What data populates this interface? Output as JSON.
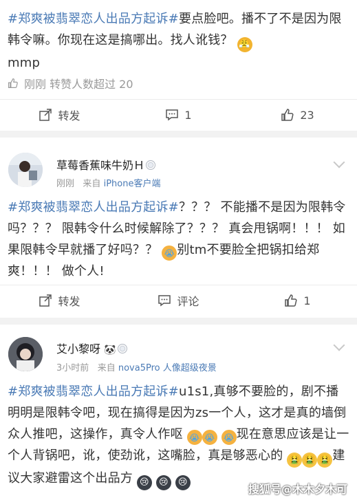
{
  "post1": {
    "text_hashtag": "#郑爽被翡翠恋人出品方起诉#",
    "text_body": "要点脸吧。播不了不是因为限韩令嘛。你现在这是搞哪出。找人讹钱？",
    "text_tail": "mmp",
    "emoji_icon": "angry-face-icon",
    "repost_note": "刚刚 转赞人数超过 20",
    "actions": {
      "repost": "转发",
      "comment": "1",
      "like": "23"
    }
  },
  "post2": {
    "username": "草莓香蕉味牛奶Ｈ",
    "meta_time": "刚刚",
    "meta_from_prefix": "来自",
    "meta_source": "iPhone客户端",
    "text_hashtag": "#郑爽被翡翠恋人出品方起诉#",
    "text_body1": "？？？ 不能播不是因为限韩令吗？？？ 限韩令什么时候解除了？？？ 真会甩锅啊！！！ 如果限韩令早就播了好吗？？",
    "text_body2": "别tm不要脸全把锅扣给郑爽！！！ 做个人!",
    "actions": {
      "repost": "转发",
      "comment": "评论",
      "like": "1"
    }
  },
  "post3": {
    "username": "艾小黎呀",
    "meta_time": "3小时前",
    "meta_from_prefix": "来自",
    "meta_source": "nova5Pro 人像超级夜景",
    "text_hashtag": "#郑爽被翡翠恋人出品方起诉#",
    "text_body1": "u1s1,真够不要脸的，剧不播明明是限韩令吧，现在搞得是因为zs一个人，这才是真的墙倒众人推吧，这操作，真令人作呕",
    "text_body2": "现在意思应该是让一个人背锅吧，讹，使劲讹，这嘴脸，真是够恶心的",
    "text_body3": "建议大家避雷这个出品方"
  },
  "watermark": "搜狐号@木木夕木可"
}
